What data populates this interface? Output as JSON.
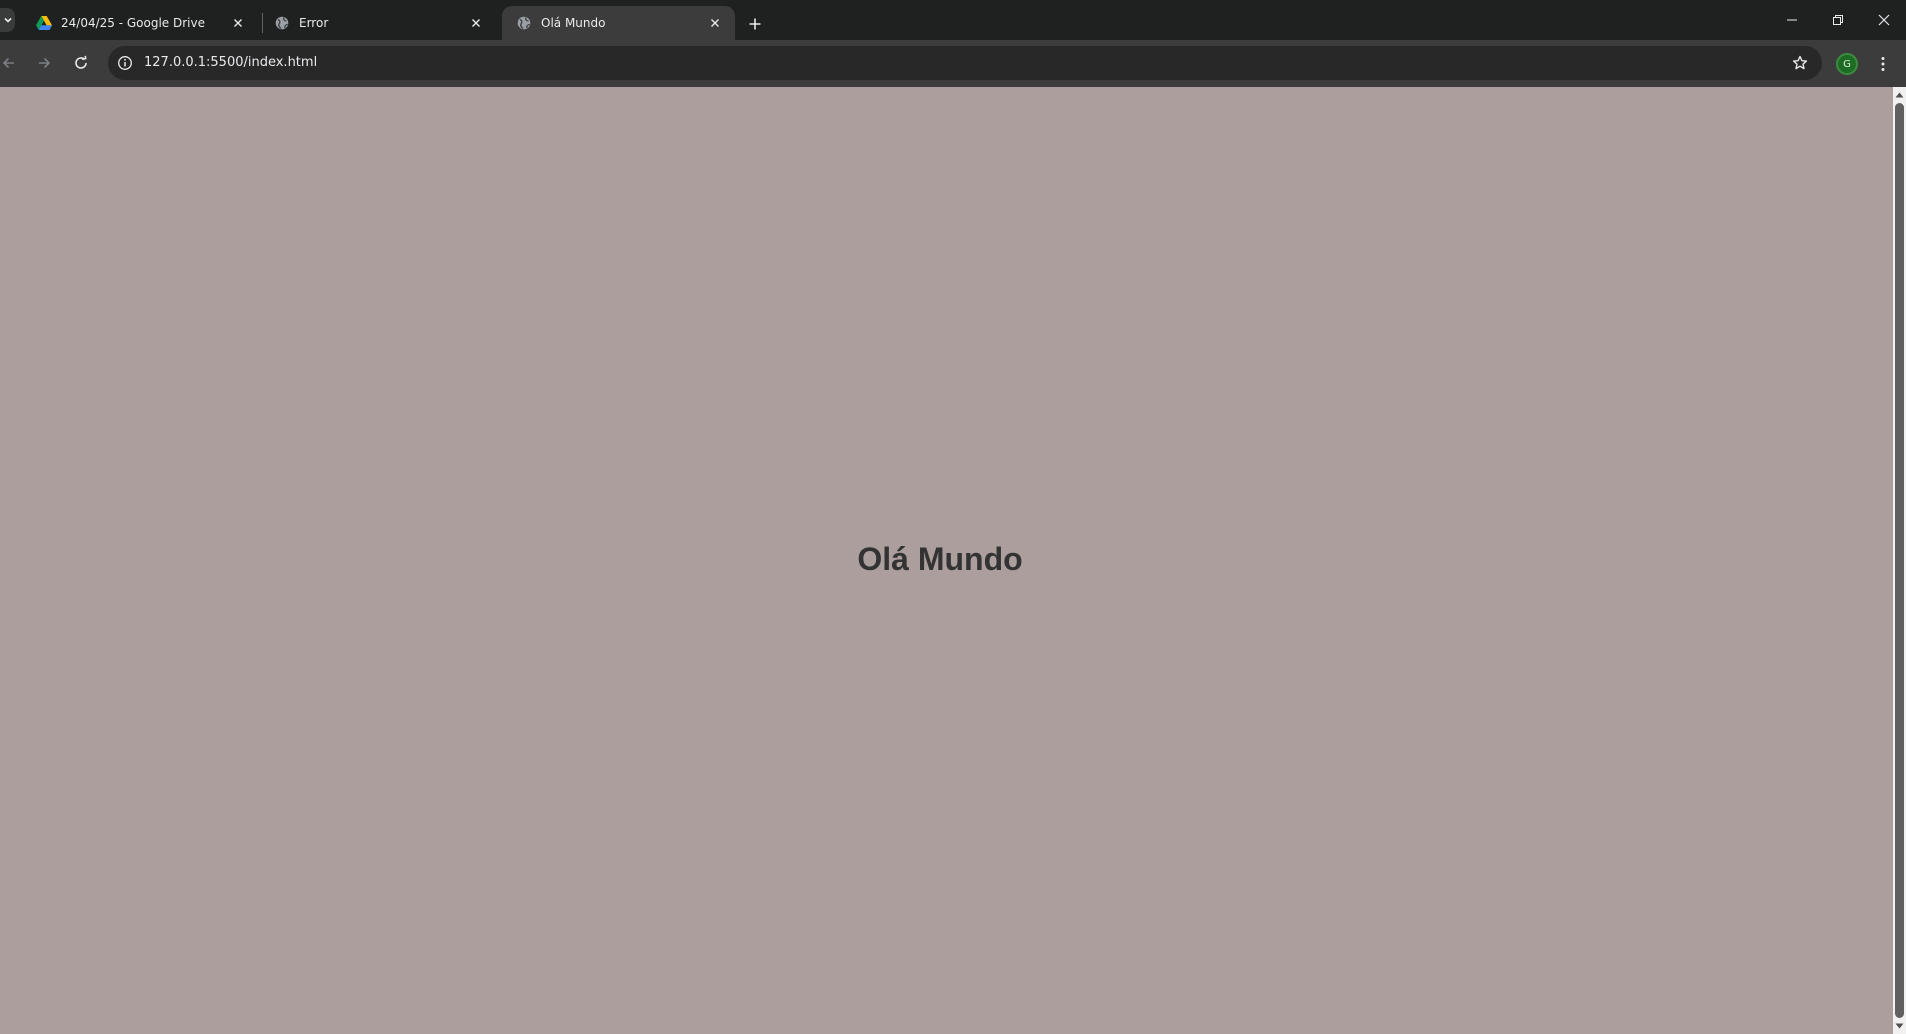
{
  "browser": {
    "tabs": [
      {
        "title": "24/04/25 - Google Drive",
        "icon": "google-drive-icon",
        "active": false
      },
      {
        "title": "Error",
        "icon": "globe-icon",
        "active": false
      },
      {
        "title": "Olá Mundo",
        "icon": "globe-icon",
        "active": true
      }
    ],
    "address_bar": {
      "url": "127.0.0.1:5500/index.html"
    },
    "profile_initial": "G"
  },
  "page": {
    "heading": "Olá Mundo",
    "background_color": "#ab9e9c",
    "text_color": "#333333"
  },
  "colors": {
    "tabstrip": "#1f2020",
    "toolbar": "#3c3c3c",
    "omnibox": "#282828",
    "profile_avatar": "#1e6b24"
  }
}
